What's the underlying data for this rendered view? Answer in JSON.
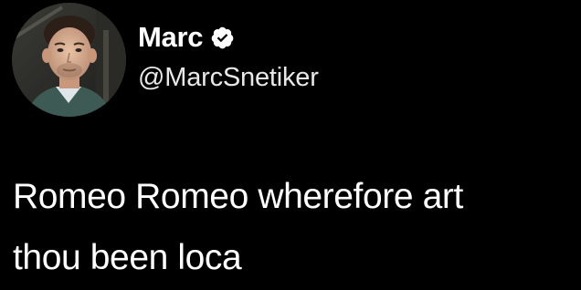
{
  "author": {
    "name": "Marc",
    "handle": "@MarcSnetiker",
    "verified": true,
    "avatar_icon": "profile-photo"
  },
  "tweet": {
    "text_line_1": "Romeo Romeo wherefore art",
    "text_line_2": "thou been loca"
  },
  "colors": {
    "background": "#000000",
    "text": "#ffffff",
    "verified_badge": "#ffffff"
  }
}
